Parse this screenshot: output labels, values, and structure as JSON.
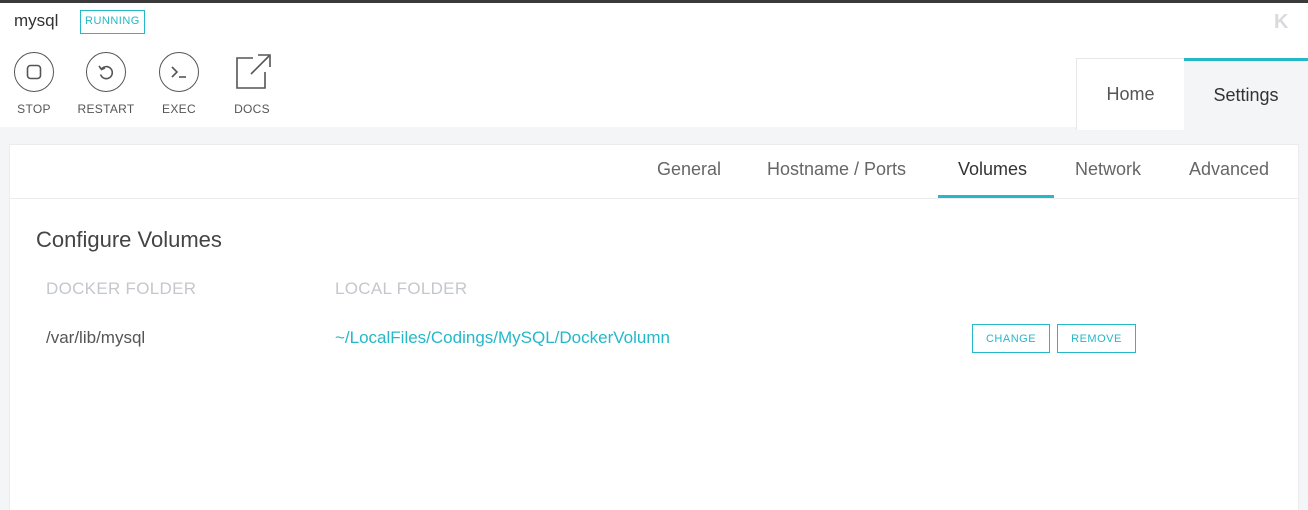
{
  "container": {
    "name": "mysql",
    "status": "RUNNING",
    "accent_color": "#24b8c8"
  },
  "logo": {
    "text": "K",
    "icon": "kitematic-logo"
  },
  "actions": [
    {
      "label": "STOP",
      "icon": "stop-icon"
    },
    {
      "label": "RESTART",
      "icon": "restart-icon"
    },
    {
      "label": "EXEC",
      "icon": "terminal-icon"
    },
    {
      "label": "DOCS",
      "icon": "external-link-icon"
    }
  ],
  "view_tabs": [
    {
      "label": "Home",
      "active": false
    },
    {
      "label": "Settings",
      "active": true
    }
  ],
  "settings_tabs": [
    {
      "label": "General",
      "active": false
    },
    {
      "label": "Hostname / Ports",
      "active": false
    },
    {
      "label": "Volumes",
      "active": true
    },
    {
      "label": "Network",
      "active": false
    },
    {
      "label": "Advanced",
      "active": false
    }
  ],
  "volumes": {
    "title": "Configure Volumes",
    "columns": [
      "DOCKER FOLDER",
      "LOCAL FOLDER"
    ],
    "rows": [
      {
        "docker_folder": "/var/lib/mysql",
        "local_folder": "~/LocalFiles/Codings/MySQL/DockerVolumn",
        "change_label": "CHANGE",
        "remove_label": "REMOVE"
      }
    ]
  }
}
